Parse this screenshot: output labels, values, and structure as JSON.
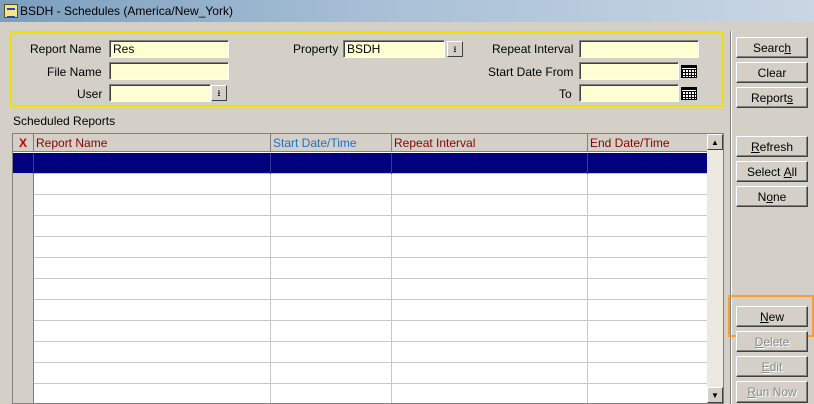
{
  "window": {
    "title": "BSDH - Schedules (America/New_York)"
  },
  "filters": {
    "report_name_label": "Report Name",
    "report_name_value": "Res",
    "file_name_label": "File Name",
    "file_name_value": "",
    "user_label": "User",
    "user_value": "",
    "property_label": "Property",
    "property_value": "BSDH",
    "repeat_interval_label": "Repeat Interval",
    "repeat_interval_value": "",
    "start_date_from_label": "Start Date From",
    "start_date_from_value": "",
    "to_label": "To",
    "to_value": ""
  },
  "scheduled": {
    "section_label": "Scheduled Reports",
    "columns": [
      {
        "label": "X",
        "color": "#c00000"
      },
      {
        "label": "Report Name",
        "color": "#8b0000"
      },
      {
        "label": "Start Date/Time",
        "color": "#1e6fcf"
      },
      {
        "label": "Repeat Interval",
        "color": "#8b0000"
      },
      {
        "label": "End Date/Time",
        "color": "#8b0000"
      }
    ],
    "selected_row_color": "#00007f"
  },
  "buttons": {
    "search": {
      "pre": "Searc",
      "key": "h",
      "post": ""
    },
    "clear": {
      "pre": "Clear",
      "key": "",
      "post": ""
    },
    "reports": {
      "pre": "Report",
      "key": "s",
      "post": ""
    },
    "refresh": {
      "pre": "",
      "key": "R",
      "post": "efresh"
    },
    "select_all": {
      "pre": "Select ",
      "key": "A",
      "post": "ll"
    },
    "none": {
      "pre": "N",
      "key": "o",
      "post": "ne"
    },
    "new": {
      "pre": "",
      "key": "N",
      "post": "ew"
    },
    "delete": {
      "pre": "",
      "key": "D",
      "post": "elete"
    },
    "edit": {
      "pre": "",
      "key": "E",
      "post": "dit"
    },
    "run_now": {
      "pre": "",
      "key": "R",
      "post": "un Now"
    }
  },
  "icons": {
    "dropdown": "chevron-down-icon",
    "calendar": "calendar-icon",
    "app": "app-icon"
  },
  "colors": {
    "filter_border": "#f0e200",
    "highlight": "#f5a03a",
    "field_bg": "#fffed2"
  }
}
